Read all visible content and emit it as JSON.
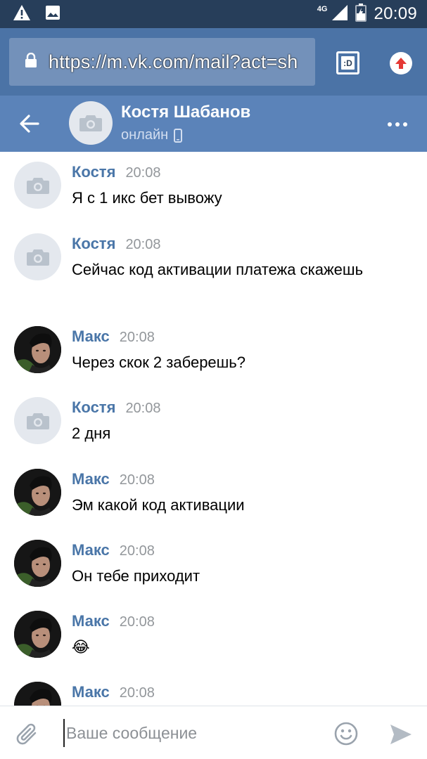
{
  "status_bar": {
    "network": "4G",
    "time": "20:09",
    "icons": [
      "warning-icon",
      "image-icon",
      "signal-icon",
      "battery-icon"
    ]
  },
  "browser": {
    "url": "https://m.vk.com/mail?act=sh",
    "tab_label": ":D",
    "icons": [
      "lock-icon",
      "upload-icon"
    ]
  },
  "chat": {
    "name": "Костя Шабанов",
    "status": "онлайн",
    "icons": [
      "back-arrow-icon",
      "camera-icon",
      "mobile-icon",
      "more-icon"
    ]
  },
  "messages": [
    {
      "author": "Костя",
      "time": "20:08",
      "text": "Я с 1 икс бет вывожу",
      "avatar": "placeholder"
    },
    {
      "author": "Костя",
      "time": "20:08",
      "text": "Сейчас код активации платежа скажешь",
      "avatar": "placeholder"
    },
    {
      "author": "Макс",
      "time": "20:08",
      "text": "Через скок 2 заберешь?",
      "avatar": "photo"
    },
    {
      "author": "Костя",
      "time": "20:08",
      "text": "2 дня",
      "avatar": "placeholder"
    },
    {
      "author": "Макс",
      "time": "20:08",
      "text": "Эм какой код активации",
      "avatar": "photo"
    },
    {
      "author": "Макс",
      "time": "20:08",
      "text": "Он тебе приходит",
      "avatar": "photo"
    },
    {
      "author": "Макс",
      "time": "20:08",
      "text": "😂",
      "avatar": "photo"
    },
    {
      "author": "Макс",
      "time": "20:08",
      "text": "",
      "avatar": "photo"
    }
  ],
  "composer": {
    "placeholder": "Ваше сообщение",
    "value": "",
    "icons": [
      "paperclip-icon",
      "smile-icon",
      "send-icon"
    ]
  },
  "colors": {
    "status_bar": "#273e5a",
    "browser_bar": "#4b73a6",
    "url_box": "#7391ba",
    "header": "#5b83b9",
    "author": "#4a76a8",
    "time": "#93979b"
  }
}
